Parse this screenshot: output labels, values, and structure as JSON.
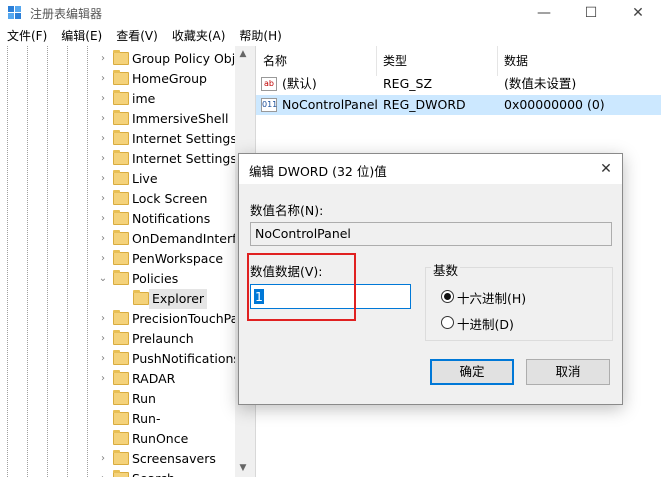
{
  "window": {
    "title": "注册表编辑器",
    "controls": {
      "minimize": "—",
      "maximize": "☐",
      "close": "✕"
    }
  },
  "menu": [
    "文件(F)",
    "编辑(E)",
    "查看(V)",
    "收藏夹(A)",
    "帮助(H)"
  ],
  "tree": {
    "items": [
      {
        "label": "Group Policy Obje",
        "expandable": true
      },
      {
        "label": "HomeGroup",
        "expandable": true
      },
      {
        "label": "ime",
        "expandable": true
      },
      {
        "label": "ImmersiveShell",
        "expandable": true
      },
      {
        "label": "Internet Settings",
        "expandable": true
      },
      {
        "label": "Internet SettingsW",
        "expandable": true
      },
      {
        "label": "Live",
        "expandable": true
      },
      {
        "label": "Lock Screen",
        "expandable": true
      },
      {
        "label": "Notifications",
        "expandable": true
      },
      {
        "label": "OnDemandInterfa",
        "expandable": true
      },
      {
        "label": "PenWorkspace",
        "expandable": true
      },
      {
        "label": "Policies",
        "expanded": true
      },
      {
        "label": "Explorer",
        "child": true,
        "selected": true
      },
      {
        "label": "PrecisionTouchPa",
        "expandable": true
      },
      {
        "label": "Prelaunch",
        "expandable": true
      },
      {
        "label": "PushNotifications",
        "expandable": true
      },
      {
        "label": "RADAR",
        "expandable": true
      },
      {
        "label": "Run",
        "expandable": false
      },
      {
        "label": "Run-",
        "expandable": false
      },
      {
        "label": "RunOnce",
        "expandable": false
      },
      {
        "label": "Screensavers",
        "expandable": true
      },
      {
        "label": "Search",
        "expandable": true
      }
    ]
  },
  "list": {
    "columns": [
      "名称",
      "类型",
      "数据"
    ],
    "rows": [
      {
        "icon": "string-value-icon",
        "icon_text": "ab",
        "name": "(默认)",
        "type": "REG_SZ",
        "data": "(数值未设置)"
      },
      {
        "icon": "binary-value-icon",
        "icon_text": "011",
        "name": "NoControlPanel",
        "type": "REG_DWORD",
        "data": "0x00000000 (0)",
        "selected": true
      }
    ]
  },
  "dialog": {
    "title": "编辑 DWORD (32 位)值",
    "name_label": "数值名称(N):",
    "name_value": "NoControlPanel",
    "data_label": "数值数据(V):",
    "data_value": "1",
    "base_label": "基数",
    "radio_hex": "十六进制(H)",
    "radio_dec": "十进制(D)",
    "base_selected": "hex",
    "ok": "确定",
    "cancel": "取消",
    "close": "✕"
  },
  "colors": {
    "selection": "#cce8ff",
    "accent": "#0078d7",
    "highlight_box": "#e02020"
  }
}
